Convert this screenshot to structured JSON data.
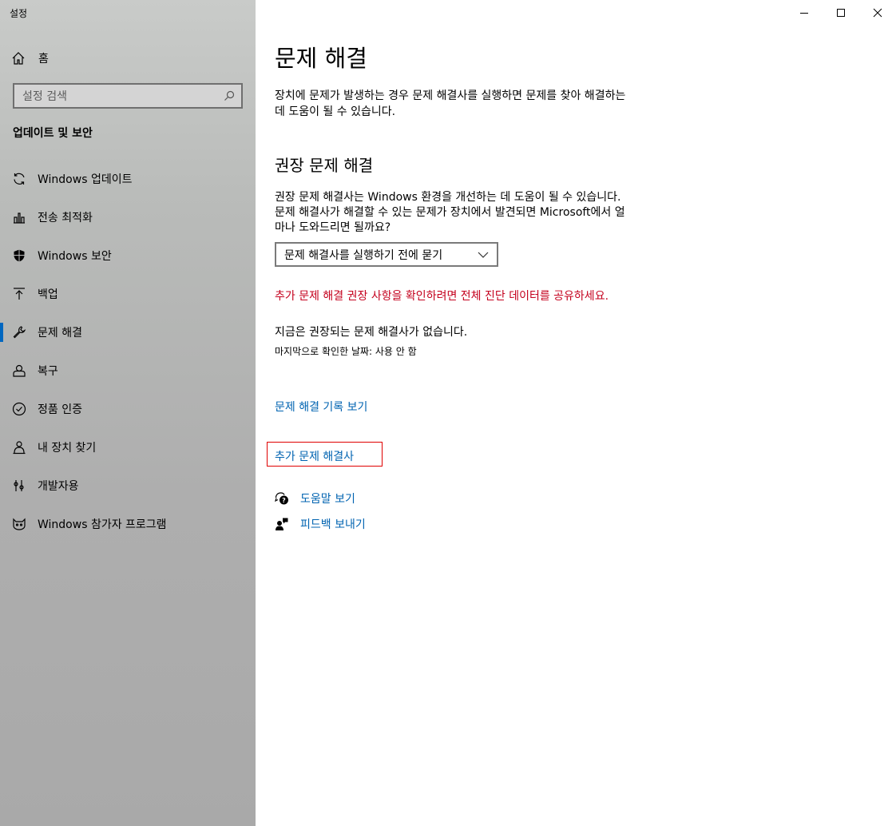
{
  "window": {
    "title": "설정"
  },
  "sidebar": {
    "home_label": "홈",
    "search_placeholder": "설정 검색",
    "section_title": "업데이트 및 보안",
    "items": [
      {
        "label": "Windows 업데이트",
        "icon": "sync-icon"
      },
      {
        "label": "전송 최적화",
        "icon": "delivery-icon"
      },
      {
        "label": "Windows 보안",
        "icon": "shield-icon"
      },
      {
        "label": "백업",
        "icon": "upload-icon"
      },
      {
        "label": "문제 해결",
        "icon": "wrench-icon",
        "active": true
      },
      {
        "label": "복구",
        "icon": "recovery-icon"
      },
      {
        "label": "정품 인증",
        "icon": "check-circle-icon"
      },
      {
        "label": "내 장치 찾기",
        "icon": "person-pin-icon"
      },
      {
        "label": "개발자용",
        "icon": "developer-icon"
      },
      {
        "label": "Windows 참가자 프로그램",
        "icon": "insider-cat-icon"
      }
    ]
  },
  "main": {
    "title": "문제 해결",
    "description": "장치에 문제가 발생하는 경우 문제 해결사를 실행하면 문제를 찾아 해결하는 데 도움이 될 수 있습니다.",
    "recommended": {
      "title": "권장 문제 해결",
      "description": "권장 문제 해결사는 Windows 환경을 개선하는 데 도움이 될 수 있습니다. 문제 해결사가 해결할 수 있는 문제가 장치에서 발견되면 Microsoft에서 얼마나 도와드리면 될까요?",
      "dropdown_value": "문제 해결사를 실행하기 전에 묻기",
      "warning": "추가 문제 해결 권장 사항을 확인하려면 전체 진단 데이터를 공유하세요.",
      "status": "지금은 권장되는 문제 해결사가 없습니다.",
      "last_checked": "마지막으로 확인한 날짜: 사용 안 함"
    },
    "history_link": "문제 해결 기록 보기",
    "more_link": "추가 문제 해결사",
    "help_link": "도움말 보기",
    "feedback_link": "피드백 보내기"
  },
  "colors": {
    "accent": "#0067c0",
    "link": "#0063b1",
    "warning": "#c4001d",
    "highlight_box": "#e00000"
  }
}
